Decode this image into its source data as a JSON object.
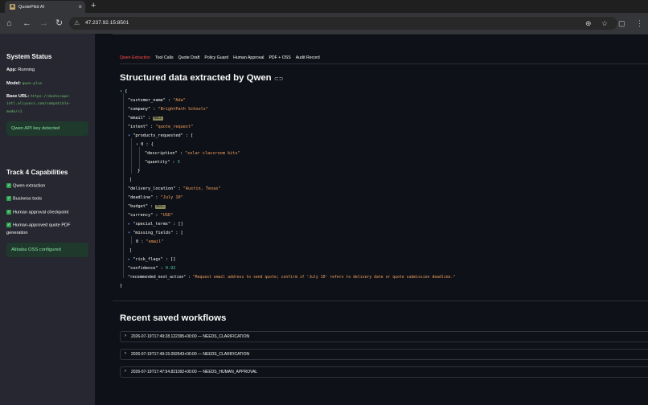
{
  "browser": {
    "tab_title": "QuotePilot AI",
    "url": "47.237.92.15:8501"
  },
  "sidebar": {
    "status_title": "System Status",
    "app_label": "App:",
    "app_value": "Running",
    "model_label": "Model:",
    "model_value": "qwen-plus",
    "base_url_label": "Base URL:",
    "base_url_line1": "https://dashscope-",
    "base_url_line2": "intl.aliyuncs.com/compatible-",
    "base_url_line3": "mode/v1",
    "api_notice": "Qwen API key detected",
    "capabilities_title": "Track 4 Capabilities",
    "capabilities": [
      "Qwen extraction",
      "Business tools",
      "Human approval checkpoint",
      "Human-approved quote PDF",
      "generation"
    ],
    "oss_notice": "Alibaba OSS configured"
  },
  "tabs": [
    "Qwen Extraction",
    "Tool Calls",
    "Quote Draft",
    "Policy Guard",
    "Human Approval",
    "PDF + OSS",
    "Audit Record"
  ],
  "extraction_heading": "Structured data extracted by Qwen",
  "json": {
    "open_brace": "{",
    "close_brace": "}",
    "customer_name_key": "\"customer_name\"",
    "customer_name_val": "\"Ada\"",
    "company_key": "\"company\"",
    "company_val": "\"BrightPath Schools\"",
    "email_key": "\"email\"",
    "null_label": "NULL",
    "intent_key": "\"intent\"",
    "intent_val": "\"quote_request\"",
    "products_key": "\"products_requested\"",
    "open_bracket": "[",
    "close_bracket": "]",
    "index_zero": "0",
    "description_key": "\"description\"",
    "description_val": "\"solar classroom kits\"",
    "quantity_key": "\"quantity\"",
    "quantity_val": "3",
    "delivery_location_key": "\"delivery_location\"",
    "delivery_location_val": "\"Austin, Texas\"",
    "deadline_key": "\"deadline\"",
    "deadline_val": "\"July 10\"",
    "budget_key": "\"budget\"",
    "currency_key": "\"currency\"",
    "currency_val": "\"USD\"",
    "special_terms_key": "\"special_terms\"",
    "empty_array": "[]",
    "missing_fields_key": "\"missing_fields\"",
    "missing_fields_val": "\"email\"",
    "risk_flags_key": "\"risk_flags\"",
    "confidence_key": "\"confidence\"",
    "confidence_val": "0.92",
    "next_action_key": "\"recommended_next_action\"",
    "next_action_val": "\"Request email address to send quote; confirm if 'July 10' refers to delivery date or quote submission deadline.\""
  },
  "workflows_heading": "Recent saved workflows",
  "workflows": [
    "2026-07-19T17:49:28.122395+00:00 — NEEDS_CLARIFICATION",
    "2026-07-19T17:49:15.092643+00:00 — NEEDS_CLARIFICATION",
    "2026-07-19T17:47:54.821092+00:00 — NEEDS_HUMAN_APPROVAL"
  ],
  "colors": {
    "accent": "#ff4b4b",
    "string": "#f5a25d",
    "number": "#4ec9b0",
    "success_bg": "#1f3a2c",
    "success_text": "#88e0a4"
  }
}
